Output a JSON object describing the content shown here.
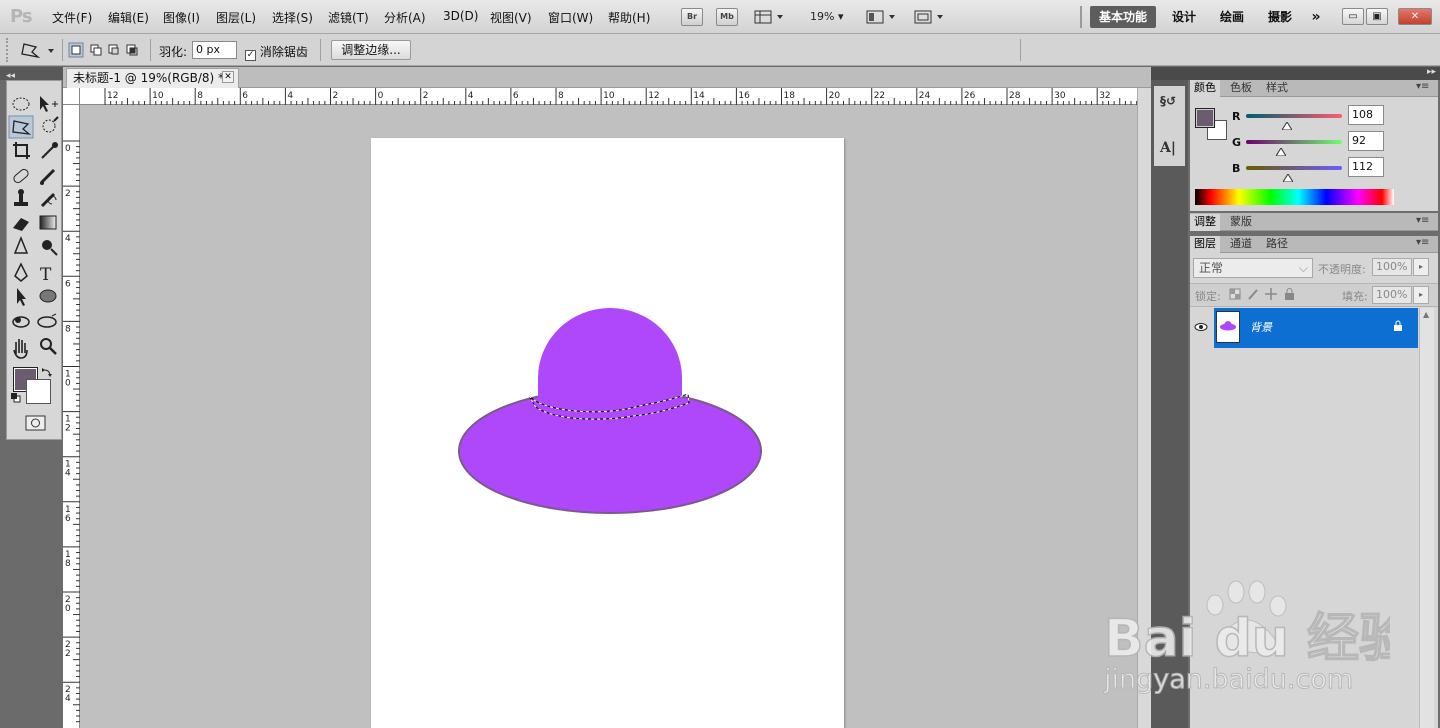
{
  "app": {
    "logo": "Ps"
  },
  "menu": [
    "文件(F)",
    "编辑(E)",
    "图像(I)",
    "图层(L)",
    "选择(S)",
    "滤镜(T)",
    "分析(A)",
    "3D(D)",
    "视图(V)",
    "窗口(W)",
    "帮助(H)"
  ],
  "appbar": {
    "bridge": "Br",
    "minibridge": "Mb",
    "zoom": "19%"
  },
  "workspaces": [
    "基本功能",
    "设计",
    "绘画",
    "摄影"
  ],
  "window_controls": {
    "minimize": "▭",
    "restore": "▣",
    "close": "✕"
  },
  "options": {
    "feather_label": "羽化:",
    "feather_value": "0 px",
    "antialias_label": "消除锯齿",
    "antialias_checked": true,
    "refine_edge": "调整边缘..."
  },
  "document": {
    "tab_title": "未标题-1 @ 19%(RGB/8) *",
    "close": "✕"
  },
  "ruler": {
    "h_labels": [
      "12",
      "10",
      "8",
      "6",
      "4",
      "2",
      "0",
      "2",
      "4",
      "6",
      "8",
      "10",
      "12",
      "14",
      "16",
      "18",
      "20",
      "22",
      "24",
      "26",
      "28",
      "30",
      "32"
    ],
    "v_labels": [
      "0",
      "2",
      "4",
      "6",
      "8",
      "10",
      "12",
      "14",
      "16",
      "18",
      "20",
      "22",
      "24"
    ]
  },
  "colors": {
    "foreground": "#6c5c70",
    "background": "#ffffff",
    "hat": "#ae48fa",
    "selection_mark": "#ffffff"
  },
  "color_panel": {
    "tabs": [
      "颜色",
      "色板",
      "样式"
    ],
    "channels": [
      {
        "label": "R",
        "value": "108",
        "fraction": 0.424
      },
      {
        "label": "G",
        "value": "92",
        "fraction": 0.361
      },
      {
        "label": "B",
        "value": "112",
        "fraction": 0.439
      }
    ]
  },
  "adjust_panel": {
    "tabs": [
      "调整",
      "蒙版"
    ]
  },
  "layers_panel": {
    "tabs": [
      "图层",
      "通道",
      "路径"
    ],
    "blend_mode": "正常",
    "opacity_label": "不透明度:",
    "opacity": "100%",
    "lock_label": "锁定:",
    "fill_label": "填充:",
    "fill": "100%",
    "layers": [
      {
        "name": "背景",
        "visible": true,
        "locked": true
      }
    ]
  },
  "watermark": {
    "brand": "Bai du 经验",
    "url": "jingyan.baidu.com"
  }
}
